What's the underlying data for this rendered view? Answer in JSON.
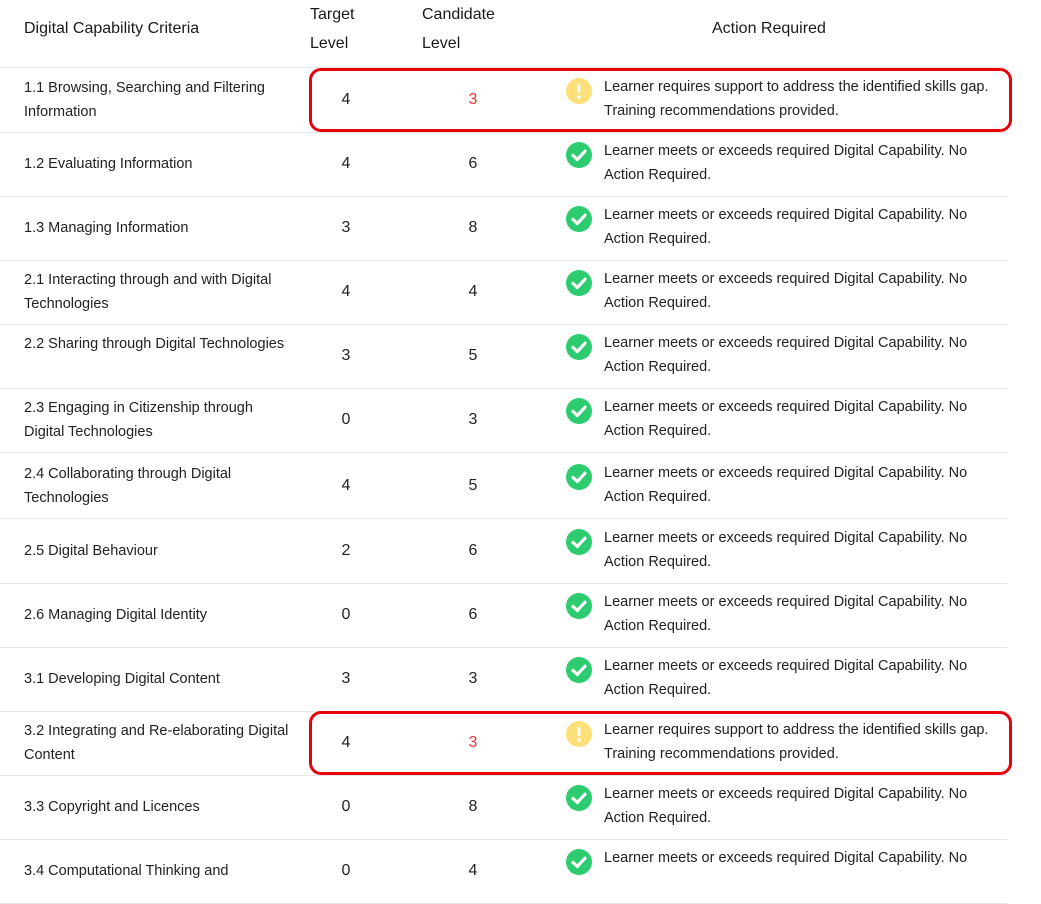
{
  "header": {
    "criteria": "Digital Capability Criteria",
    "target_line1": "Target",
    "target_line2": "Level",
    "candidate_line1": "Candidate",
    "candidate_line2": "Level",
    "action": "Action Required"
  },
  "status_colors": {
    "met": "#2ecc71",
    "gap": "#fde07a",
    "gap_value": "#e53935",
    "highlight": "#e8000b"
  },
  "rows": [
    {
      "criteria": "1.1 Browsing, Searching and Filtering Information",
      "target": "4",
      "candidate": "3",
      "status": "gap",
      "action": "Learner requires support to address the identified skills gap. Training recommendations provided."
    },
    {
      "criteria": "1.2 Evaluating Information",
      "target": "4",
      "candidate": "6",
      "status": "met",
      "action": "Learner meets or exceeds required Digital Capability. No Action Required."
    },
    {
      "criteria": "1.3 Managing Information",
      "target": "3",
      "candidate": "8",
      "status": "met",
      "action": "Learner meets or exceeds required Digital Capability. No Action Required."
    },
    {
      "criteria": "2.1 Interacting through and with Digital Technologies",
      "target": "4",
      "candidate": "4",
      "status": "met",
      "action": "Learner meets or exceeds required Digital Capability. No Action Required."
    },
    {
      "criteria": "2.2 Sharing through Digital Technologies",
      "target": "3",
      "candidate": "5",
      "status": "met",
      "action": "Learner meets or exceeds required Digital Capability. No Action Required."
    },
    {
      "criteria": "2.3 Engaging in Citizenship through Digital Technologies",
      "target": "0",
      "candidate": "3",
      "status": "met",
      "action": "Learner meets or exceeds required Digital Capability. No Action Required."
    },
    {
      "criteria": "2.4 Collaborating through Digital Technologies",
      "target": "4",
      "candidate": "5",
      "status": "met",
      "action": "Learner meets or exceeds required Digital Capability. No Action Required."
    },
    {
      "criteria": "2.5 Digital Behaviour",
      "target": "2",
      "candidate": "6",
      "status": "met",
      "action": "Learner meets or exceeds required Digital Capability. No Action Required."
    },
    {
      "criteria": "2.6 Managing Digital Identity",
      "target": "0",
      "candidate": "6",
      "status": "met",
      "action": "Learner meets or exceeds required Digital Capability. No Action Required."
    },
    {
      "criteria": "3.1 Developing Digital Content",
      "target": "3",
      "candidate": "3",
      "status": "met",
      "action": "Learner meets or exceeds required Digital Capability. No Action Required."
    },
    {
      "criteria": "3.2 Integrating and Re-elaborating Digital Content",
      "target": "4",
      "candidate": "3",
      "status": "gap",
      "action": "Learner requires support to address the identified skills gap. Training recommendations provided."
    },
    {
      "criteria": "3.3 Copyright and Licences",
      "target": "0",
      "candidate": "8",
      "status": "met",
      "action": "Learner meets or exceeds required Digital Capability. No Action Required."
    },
    {
      "criteria": "3.4 Computational Thinking and",
      "target": "0",
      "candidate": "4",
      "status": "met",
      "action": "Learner meets or exceeds required Digital Capability. No"
    }
  ]
}
